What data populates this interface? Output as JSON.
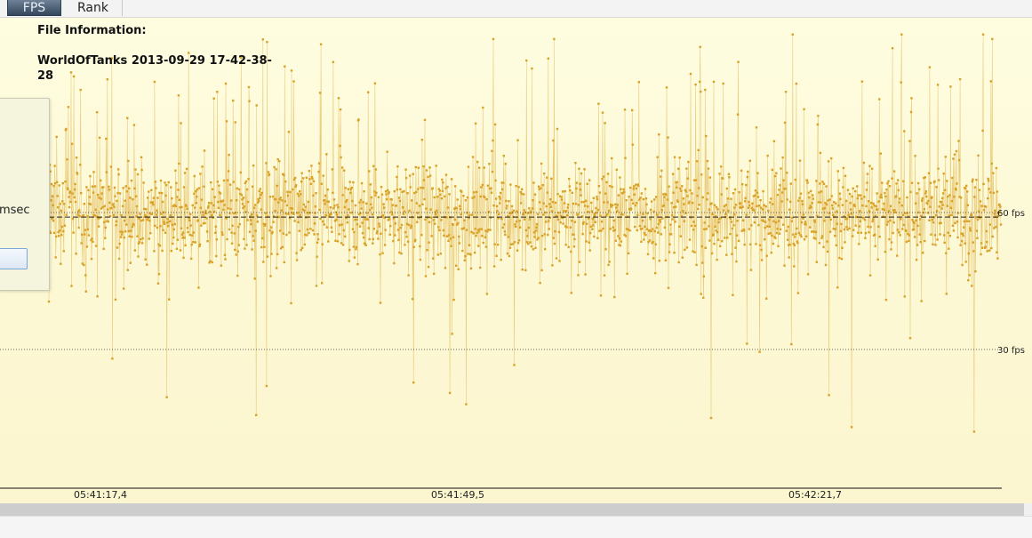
{
  "tabs": [
    {
      "label": "FPS",
      "active": true
    },
    {
      "label": "Rank",
      "active": false
    }
  ],
  "file_info": {
    "heading": "File Information:",
    "name": "WorldOfTanks 2013-09-29 17-42-38-28"
  },
  "side_panel": {
    "unit_text": "msec"
  },
  "colors": {
    "series": "#d9a227",
    "background": "#fdfbd8",
    "reference_line": "#333333",
    "average_line": "#222222"
  },
  "chart_data": {
    "type": "line",
    "title": "",
    "xlabel": "",
    "ylabel": "",
    "x_tick_labels": [
      "05:41:17,4",
      "05:41:49,5",
      "05:42:21,7"
    ],
    "reference_lines": [
      {
        "value": 60,
        "label": "60 fps",
        "style": "dotted"
      },
      {
        "value": 30,
        "label": "30 fps",
        "style": "dotted"
      }
    ],
    "average_fps": 59,
    "y_range_fps": [
      -10,
      100
    ],
    "grid": false,
    "legend": "none",
    "series": [
      {
        "description": "per-frame FPS, dense oscillation around the 60 fps line",
        "typical_range_fps": [
          50,
          70
        ],
        "max_fps": 99,
        "min_fps": 12,
        "peaks_fps": [
          92,
          98,
          99,
          96,
          99,
          99,
          98
        ],
        "dips_fps": [
          28,
          22,
          18,
          15,
          20,
          13,
          12
        ]
      }
    ]
  }
}
